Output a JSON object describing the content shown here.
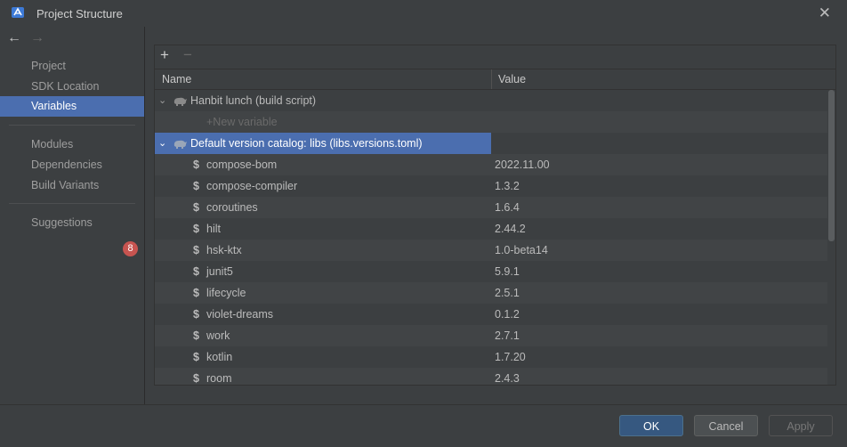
{
  "window": {
    "title": "Project Structure"
  },
  "sidebar": {
    "items": [
      {
        "label": "Project"
      },
      {
        "label": "SDK Location"
      },
      {
        "label": "Variables",
        "selected": true
      },
      {
        "label": "Modules"
      },
      {
        "label": "Dependencies"
      },
      {
        "label": "Build Variants"
      },
      {
        "label": "Suggestions",
        "badge": "8"
      }
    ]
  },
  "table": {
    "columns": {
      "name": "Name",
      "value": "Value"
    },
    "groups": [
      {
        "title": "Hanbit lunch (build script)",
        "new_variable": "+New variable"
      },
      {
        "title": "Default version catalog: libs (libs.versions.toml)"
      }
    ],
    "variables": [
      {
        "name": "compose-bom",
        "value": "2022.11.00"
      },
      {
        "name": "compose-compiler",
        "value": "1.3.2"
      },
      {
        "name": "coroutines",
        "value": "1.6.4"
      },
      {
        "name": "hilt",
        "value": "2.44.2"
      },
      {
        "name": "hsk-ktx",
        "value": "1.0-beta14"
      },
      {
        "name": "junit5",
        "value": "5.9.1"
      },
      {
        "name": "lifecycle",
        "value": "2.5.1"
      },
      {
        "name": "violet-dreams",
        "value": "0.1.2"
      },
      {
        "name": "work",
        "value": "2.7.1"
      },
      {
        "name": "kotlin",
        "value": "1.7.20"
      },
      {
        "name": "room",
        "value": "2.4.3"
      }
    ]
  },
  "footer": {
    "ok": "OK",
    "cancel": "Cancel",
    "apply": "Apply"
  },
  "colors": {
    "selection": "#4b6eaf",
    "badge": "#c75450",
    "ok_button": "#365880",
    "background": "#3c3f41"
  },
  "icons": [
    "android-studio-icon",
    "close-icon",
    "back-arrow-icon",
    "forward-arrow-icon",
    "add-icon",
    "remove-icon",
    "chevron-down-icon",
    "gradle-elephant-icon",
    "dollar-icon"
  ]
}
